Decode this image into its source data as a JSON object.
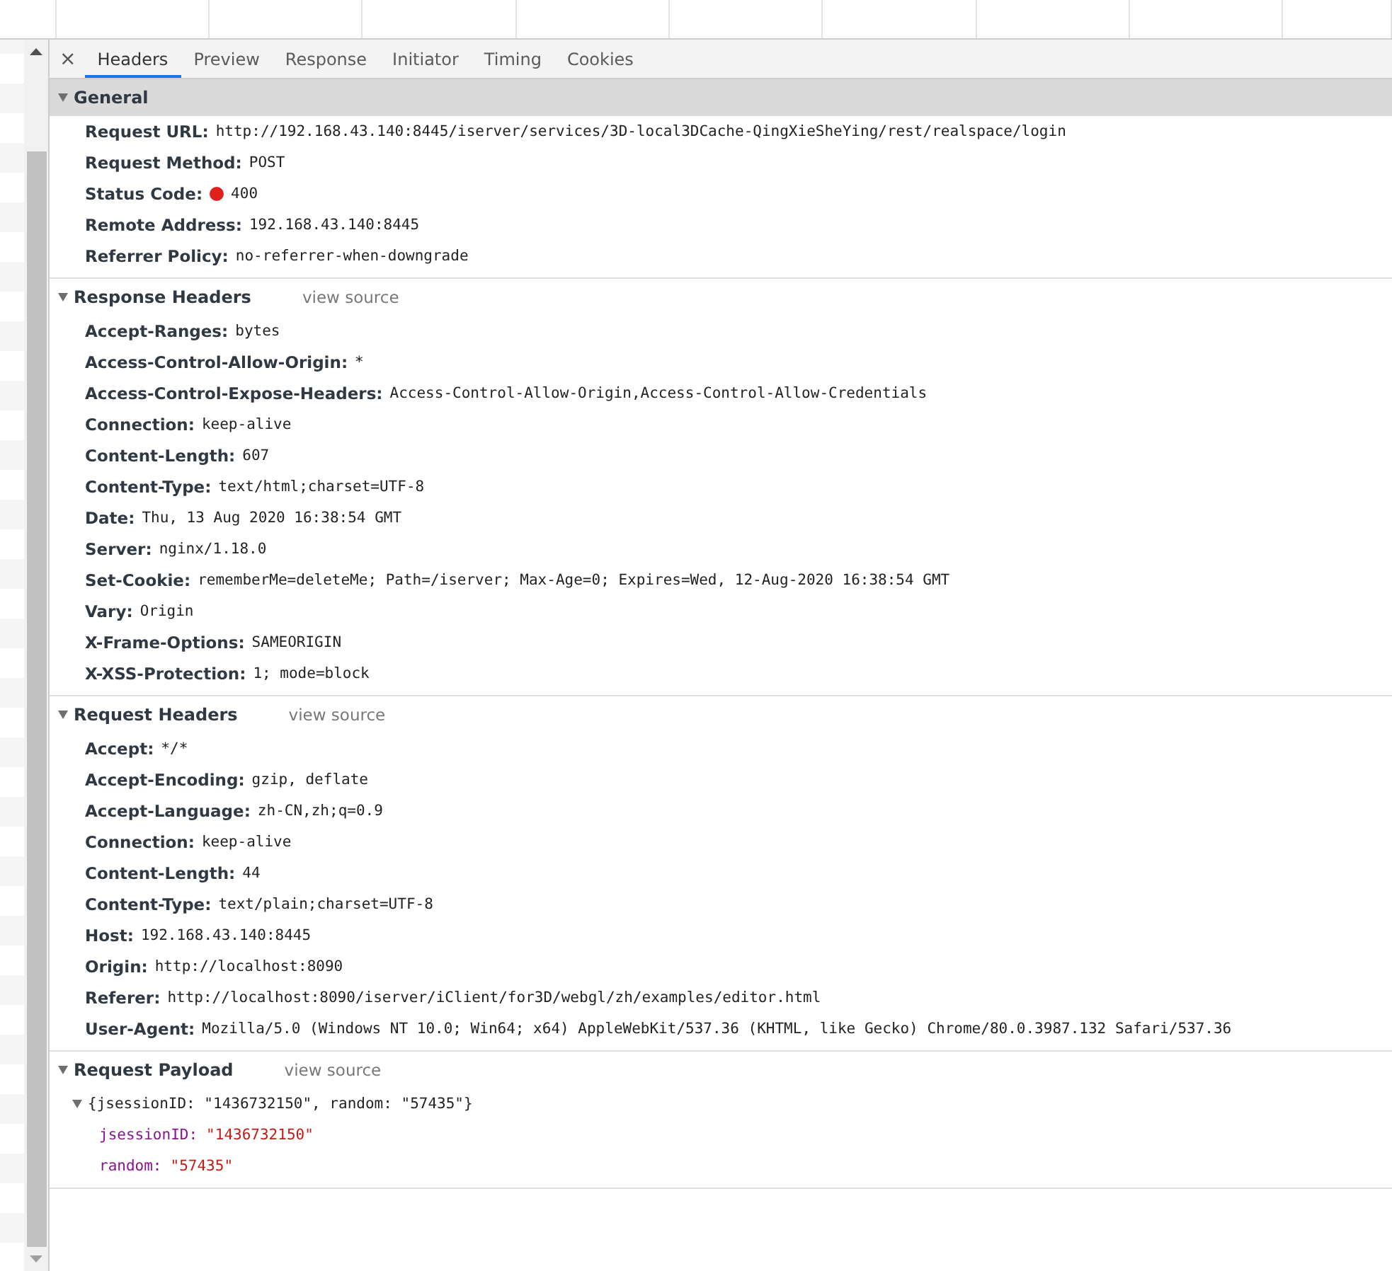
{
  "close_label": "×",
  "tabs": [
    {
      "label": "Headers",
      "selected": true
    },
    {
      "label": "Preview",
      "selected": false
    },
    {
      "label": "Response",
      "selected": false
    },
    {
      "label": "Initiator",
      "selected": false
    },
    {
      "label": "Timing",
      "selected": false
    },
    {
      "label": "Cookies",
      "selected": false
    }
  ],
  "sections": [
    {
      "kind": "headers",
      "title": "General",
      "highlighted": true,
      "expanded": true,
      "rows": [
        {
          "name": "Request URL:",
          "value": "http://192.168.43.140:8445/iserver/services/3D-local3DCache-QingXieSheYing/rest/realspace/login"
        },
        {
          "name": "Request Method:",
          "value": "POST"
        },
        {
          "name": "Status Code:",
          "value": "400",
          "color": "#e0201c"
        },
        {
          "name": "Remote Address:",
          "value": "192.168.43.140:8445"
        },
        {
          "name": "Referrer Policy:",
          "value": "no-referrer-when-downgrade"
        }
      ]
    },
    {
      "kind": "headers",
      "title": "Response Headers",
      "highlighted": false,
      "expanded": true,
      "view_source": "view source",
      "rows": [
        {
          "name": "Accept-Ranges:",
          "value": "bytes"
        },
        {
          "name": "Access-Control-Allow-Origin:",
          "value": "*"
        },
        {
          "name": "Access-Control-Expose-Headers:",
          "value": "Access-Control-Allow-Origin,Access-Control-Allow-Credentials"
        },
        {
          "name": "Connection:",
          "value": "keep-alive"
        },
        {
          "name": "Content-Length:",
          "value": "607"
        },
        {
          "name": "Content-Type:",
          "value": "text/html;charset=UTF-8"
        },
        {
          "name": "Date:",
          "value": "Thu, 13 Aug 2020 16:38:54 GMT"
        },
        {
          "name": "Server:",
          "value": "nginx/1.18.0"
        },
        {
          "name": "Set-Cookie:",
          "value": "rememberMe=deleteMe; Path=/iserver; Max-Age=0; Expires=Wed, 12-Aug-2020 16:38:54 GMT"
        },
        {
          "name": "Vary:",
          "value": "Origin"
        },
        {
          "name": "X-Frame-Options:",
          "value": "SAMEORIGIN"
        },
        {
          "name": "X-XSS-Protection:",
          "value": "1; mode=block"
        }
      ]
    },
    {
      "kind": "headers",
      "title": "Request Headers",
      "highlighted": false,
      "expanded": true,
      "view_source": "view source",
      "rows": [
        {
          "name": "Accept:",
          "value": "*/*"
        },
        {
          "name": "Accept-Encoding:",
          "value": "gzip, deflate"
        },
        {
          "name": "Accept-Language:",
          "value": "zh-CN,zh;q=0.9"
        },
        {
          "name": "Connection:",
          "value": "keep-alive"
        },
        {
          "name": "Content-Length:",
          "value": "44"
        },
        {
          "name": "Content-Type:",
          "value": "text/plain;charset=UTF-8"
        },
        {
          "name": "Host:",
          "value": "192.168.43.140:8445"
        },
        {
          "name": "Origin:",
          "value": "http://localhost:8090"
        },
        {
          "name": "Referer:",
          "value": "http://localhost:8090/iserver/iClient/for3D/webgl/zh/examples/editor.html"
        },
        {
          "name": "User-Agent:",
          "value": "Mozilla/5.0 (Windows NT 10.0; Win64; x64) AppleWebKit/537.36 (KHTML, like Gecko) Chrome/80.0.3987.132 Safari/537.36"
        }
      ]
    },
    {
      "kind": "payload",
      "title": "Request Payload",
      "highlighted": false,
      "expanded": true,
      "view_source": "view source",
      "object": {
        "summary": "{jsessionID: \"1436732150\", random: \"57435\"}",
        "expanded": true,
        "fields": [
          {
            "key": "jsessionID:",
            "value": "\"1436732150\""
          },
          {
            "key": "random:",
            "value": "\"57435\""
          }
        ]
      }
    }
  ]
}
